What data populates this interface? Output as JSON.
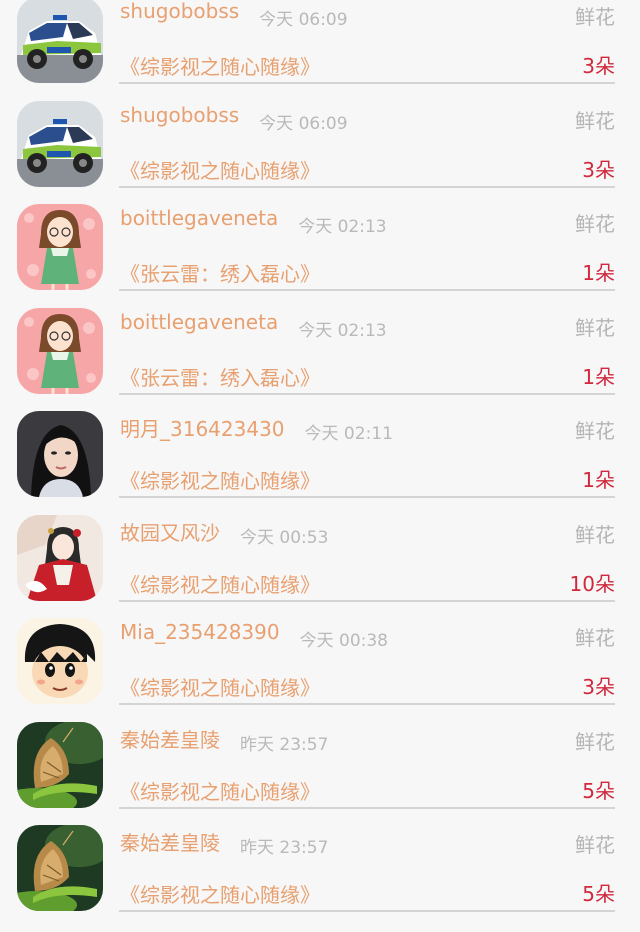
{
  "gift_items": [
    {
      "user": "shugobobss",
      "time": "今天 06:09",
      "gift_type": "鲜花",
      "book": "《综影视之随心随缘》",
      "amount": "3朵",
      "avatar_icon": "rally-car-avatar-icon"
    },
    {
      "user": "shugobobss",
      "time": "今天 06:09",
      "gift_type": "鲜花",
      "book": "《综影视之随心随缘》",
      "amount": "3朵",
      "avatar_icon": "rally-car-avatar-icon"
    },
    {
      "user": "boittlegaveneta",
      "time": "今天 02:13",
      "gift_type": "鲜花",
      "book": "《张云雷：绣入磊心》",
      "amount": "1朵",
      "avatar_icon": "cartoon-girl-avatar-icon"
    },
    {
      "user": "boittlegaveneta",
      "time": "今天 02:13",
      "gift_type": "鲜花",
      "book": "《张云雷：绣入磊心》",
      "amount": "1朵",
      "avatar_icon": "cartoon-girl-avatar-icon"
    },
    {
      "user": "明月_316423430",
      "time": "今天 02:11",
      "gift_type": "鲜花",
      "book": "《综影视之随心随缘》",
      "amount": "1朵",
      "avatar_icon": "girl-portrait-avatar-icon"
    },
    {
      "user": "故园又风沙",
      "time": "今天 00:53",
      "gift_type": "鲜花",
      "book": "《综影视之随心随缘》",
      "amount": "10朵",
      "avatar_icon": "costume-girl-avatar-icon"
    },
    {
      "user": "Mia_235428390",
      "time": "今天 00:38",
      "gift_type": "鲜花",
      "book": "《综影视之随心随缘》",
      "amount": "3朵",
      "avatar_icon": "anime-boy-avatar-icon"
    },
    {
      "user": "秦始差皇陵",
      "time": "昨天 23:57",
      "gift_type": "鲜花",
      "book": "《综影视之随心随缘》",
      "amount": "5朵",
      "avatar_icon": "butterfly-avatar-icon"
    },
    {
      "user": "秦始差皇陵",
      "time": "昨天 23:57",
      "gift_type": "鲜花",
      "book": "《综影视之随心随缘》",
      "amount": "5朵",
      "avatar_icon": "butterfly-avatar-icon"
    }
  ],
  "colors": {
    "name_orange": "#e8a070",
    "amount_red": "#d0283c",
    "muted_gray": "#b5b5b5",
    "divider": "#d4d4d4",
    "background": "#f7f7f7"
  }
}
